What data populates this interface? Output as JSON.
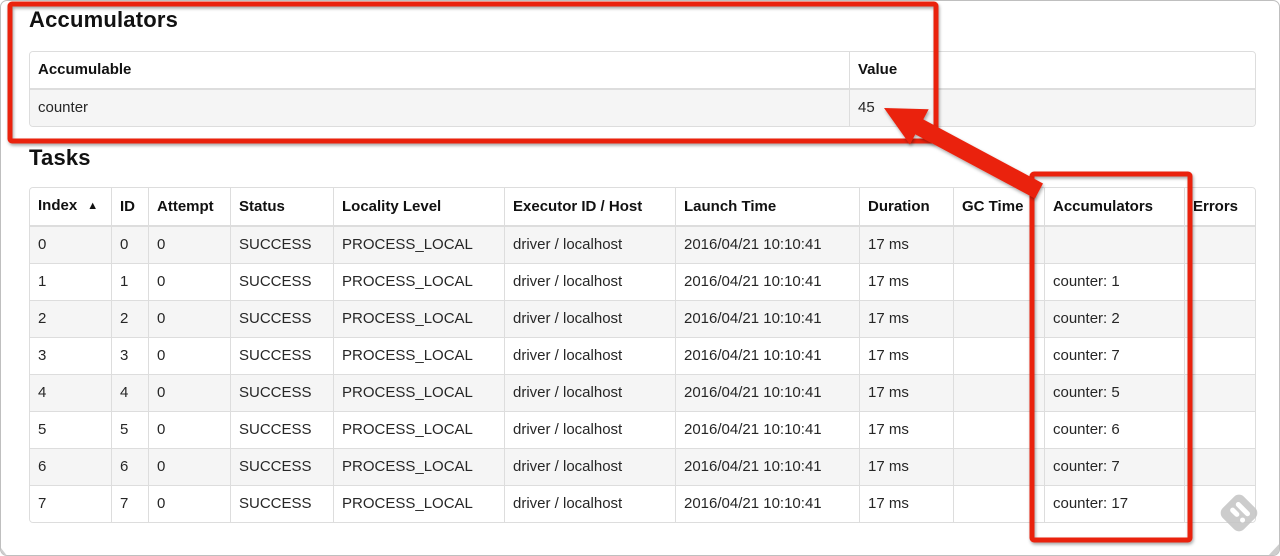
{
  "accumulators_section": {
    "title": "Accumulators",
    "table": {
      "columns": [
        "Accumulable",
        "Value"
      ],
      "rows": [
        [
          "counter",
          "45"
        ]
      ]
    }
  },
  "tasks_section": {
    "title": "Tasks",
    "sort_icon": "▲",
    "sorted_column": "Index",
    "table": {
      "columns": [
        "Index",
        "ID",
        "Attempt",
        "Status",
        "Locality Level",
        "Executor ID / Host",
        "Launch Time",
        "Duration",
        "GC Time",
        "Accumulators",
        "Errors"
      ],
      "rows": [
        [
          "0",
          "0",
          "0",
          "SUCCESS",
          "PROCESS_LOCAL",
          "driver / localhost",
          "2016/04/21 10:10:41",
          "17 ms",
          "",
          "",
          ""
        ],
        [
          "1",
          "1",
          "0",
          "SUCCESS",
          "PROCESS_LOCAL",
          "driver / localhost",
          "2016/04/21 10:10:41",
          "17 ms",
          "",
          "counter: 1",
          ""
        ],
        [
          "2",
          "2",
          "0",
          "SUCCESS",
          "PROCESS_LOCAL",
          "driver / localhost",
          "2016/04/21 10:10:41",
          "17 ms",
          "",
          "counter: 2",
          ""
        ],
        [
          "3",
          "3",
          "0",
          "SUCCESS",
          "PROCESS_LOCAL",
          "driver / localhost",
          "2016/04/21 10:10:41",
          "17 ms",
          "",
          "counter: 7",
          ""
        ],
        [
          "4",
          "4",
          "0",
          "SUCCESS",
          "PROCESS_LOCAL",
          "driver / localhost",
          "2016/04/21 10:10:41",
          "17 ms",
          "",
          "counter: 5",
          ""
        ],
        [
          "5",
          "5",
          "0",
          "SUCCESS",
          "PROCESS_LOCAL",
          "driver / localhost",
          "2016/04/21 10:10:41",
          "17 ms",
          "",
          "counter: 6",
          ""
        ],
        [
          "6",
          "6",
          "0",
          "SUCCESS",
          "PROCESS_LOCAL",
          "driver / localhost",
          "2016/04/21 10:10:41",
          "17 ms",
          "",
          "counter: 7",
          ""
        ],
        [
          "7",
          "7",
          "0",
          "SUCCESS",
          "PROCESS_LOCAL",
          "driver / localhost",
          "2016/04/21 10:10:41",
          "17 ms",
          "",
          "counter: 17",
          ""
        ]
      ]
    }
  },
  "annotations": {
    "accent_color": "#ea2310",
    "watermark_color": "#c6c6c6"
  }
}
